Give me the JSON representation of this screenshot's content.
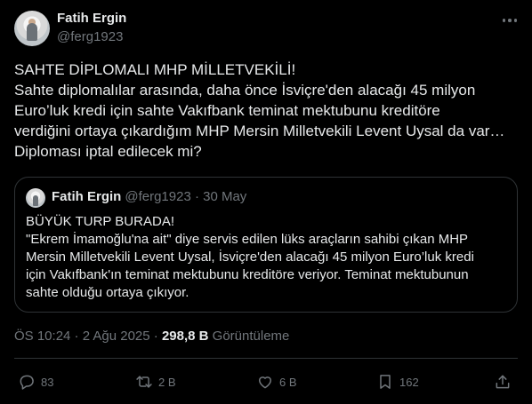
{
  "author": {
    "name": "Fatih Ergin",
    "handle": "@ferg1923"
  },
  "tweet": {
    "lines": [
      "SAHTE DİPLOMALI MHP MİLLETVEKİLİ!",
      "Sahte diplomalılar arasında, daha önce İsviçre'den alacağı 45 milyon",
      "Euro’luk kredi için sahte Vakıfbank teminat mektubunu kreditöre",
      "verdiğini ortaya çıkardığım MHP Mersin Milletvekili Levent Uysal da var…",
      "Diploması iptal edilecek mi?"
    ]
  },
  "quote": {
    "name": "Fatih Ergin",
    "meta": "@ferg1923 · 30 May",
    "lines": [
      "BÜYÜK TURP BURADA!",
      "\"Ekrem İmamoğlu'na ait\" diye servis edilen lüks araçların sahibi çıkan MHP",
      "Mersin Milletvekili Levent Uysal, İsviçre'den alacağı 45 milyon Euro’luk kredi",
      "için Vakıfbank'ın teminat mektubunu kreditöre veriyor. Teminat mektubunun",
      "sahte olduğu ortaya çıkıyor."
    ]
  },
  "meta": {
    "time_date": "ÖS 10:24 · 2 Ağu 2025 · ",
    "views": "298,8 B",
    "views_label": " Görüntüleme"
  },
  "actions": {
    "reply": {
      "icon": "reply-icon",
      "count": "83"
    },
    "retweet": {
      "icon": "retweet-icon",
      "count": "2 B"
    },
    "like": {
      "icon": "heart-icon",
      "count": "6 B"
    },
    "bookmark": {
      "icon": "bookmark-icon",
      "count": "162"
    },
    "share": {
      "icon": "share-icon"
    }
  },
  "colors": {
    "background": "#000000",
    "text": "#e7e9ea",
    "secondary": "#71767b",
    "border": "#2f3336"
  }
}
